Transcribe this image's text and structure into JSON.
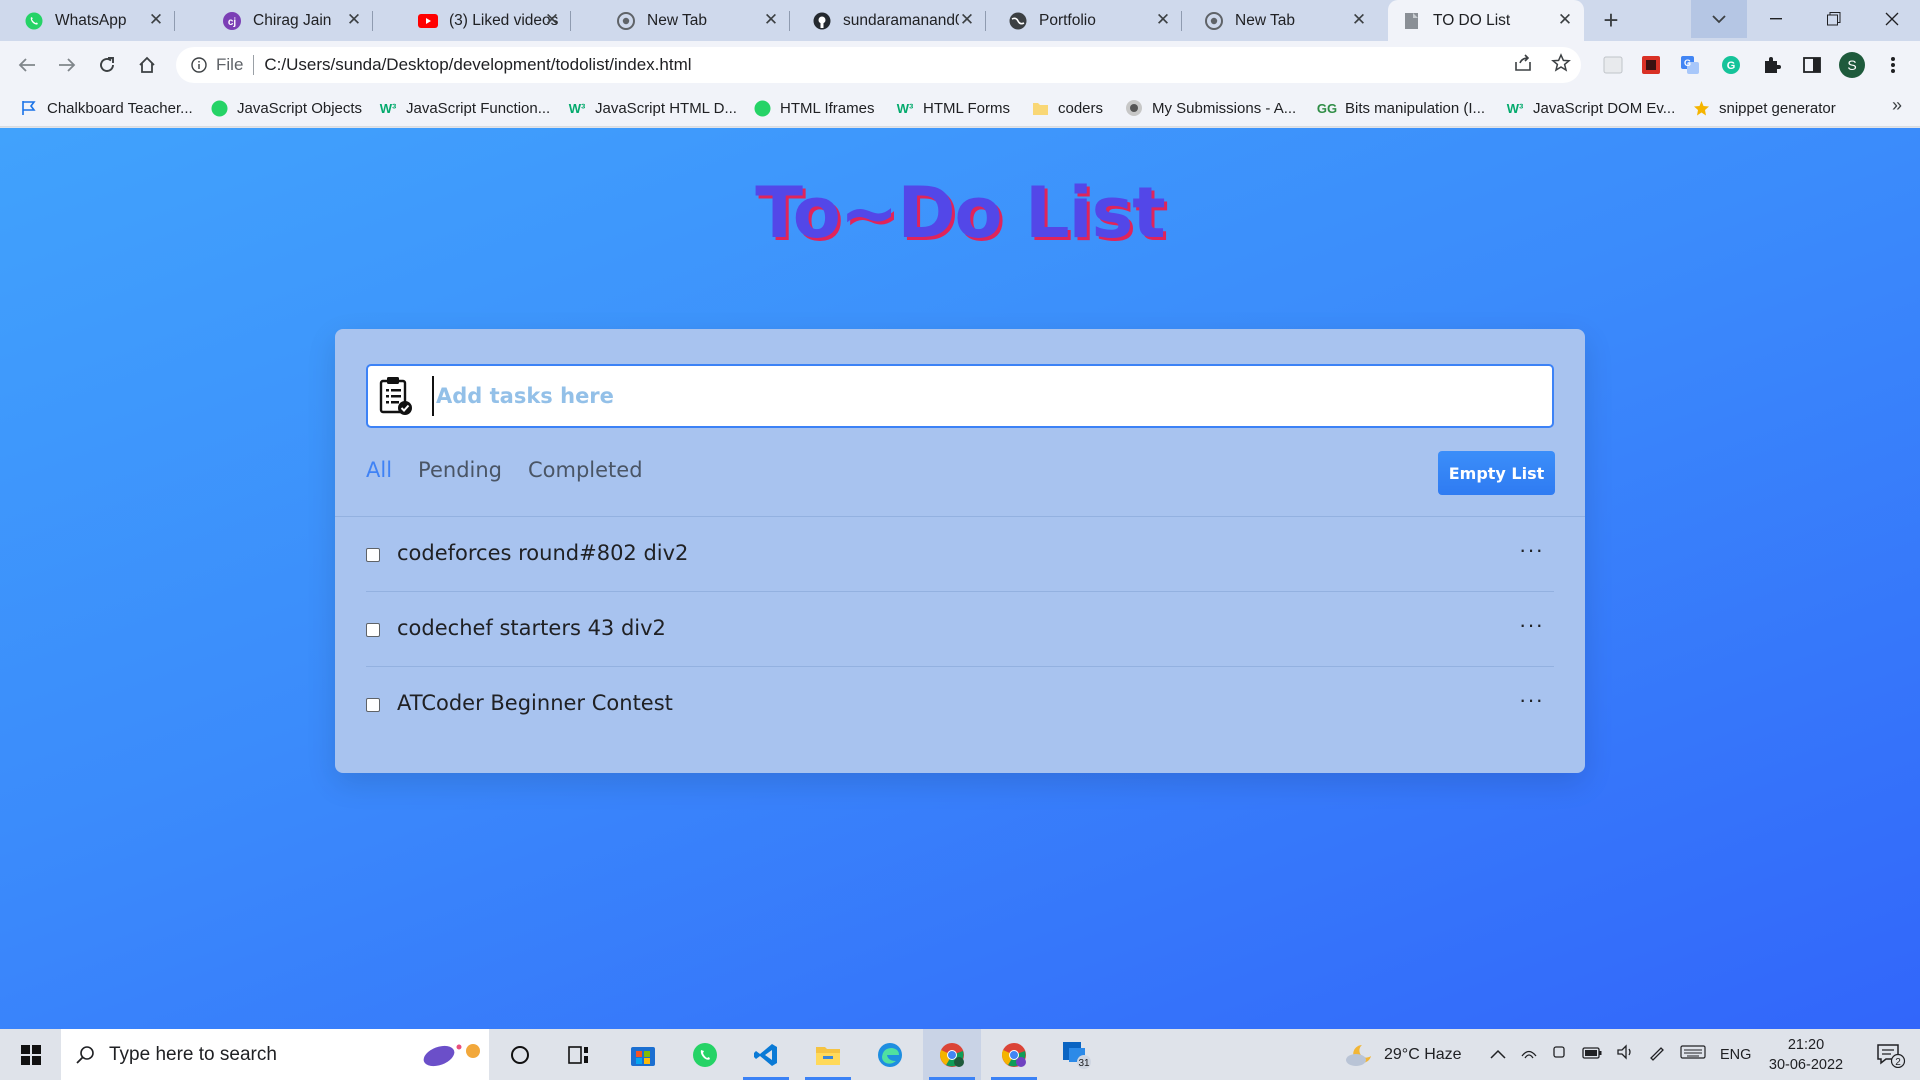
{
  "browser": {
    "tabs": [
      {
        "title": "WhatsApp",
        "icon": "whatsapp-icon",
        "active": false
      },
      {
        "title": "Chirag Jain",
        "icon": "cj-logo-icon",
        "active": false
      },
      {
        "title": "(3) Liked videos -",
        "icon": "youtube-icon",
        "active": false
      },
      {
        "title": "New Tab",
        "icon": "chrome-icon",
        "active": false
      },
      {
        "title": "sundaramanand0",
        "icon": "github-icon",
        "active": false
      },
      {
        "title": "Portfolio",
        "icon": "globe-icon",
        "active": false
      },
      {
        "title": "New Tab",
        "icon": "chrome-icon",
        "active": false
      },
      {
        "title": "TO DO List",
        "icon": "page-icon",
        "active": true
      }
    ],
    "address": {
      "scheme_label": "File",
      "url": "C:/Users/sunda/Desktop/development/todolist/index.html"
    },
    "profile_initial": "S",
    "bookmarks": [
      {
        "label": "Chalkboard Teacher...",
        "icon": "flag-icon"
      },
      {
        "label": "JavaScript Objects",
        "icon": "whatsapp-icon"
      },
      {
        "label": "JavaScript Function...",
        "icon": "w3schools-icon"
      },
      {
        "label": "JavaScript HTML D...",
        "icon": "w3schools-icon"
      },
      {
        "label": "HTML Iframes",
        "icon": "whatsapp-icon"
      },
      {
        "label": "HTML Forms",
        "icon": "w3schools-icon"
      },
      {
        "label": "coders",
        "icon": "folder-icon"
      },
      {
        "label": "My Submissions - A...",
        "icon": "atcoder-icon"
      },
      {
        "label": "Bits manipulation (I...",
        "icon": "gfg-icon"
      },
      {
        "label": "JavaScript DOM Ev...",
        "icon": "w3schools-icon"
      },
      {
        "label": "snippet generator",
        "icon": "star-badge-icon"
      }
    ],
    "bookmarks_overflow": "»"
  },
  "app": {
    "title": "To~Do List",
    "input_placeholder": "Add tasks here",
    "filters": [
      {
        "label": "All",
        "active": true
      },
      {
        "label": "Pending",
        "active": false
      },
      {
        "label": "Completed",
        "active": false
      }
    ],
    "empty_button": "Empty List",
    "tasks": [
      {
        "label": "codeforces round#802 div2",
        "checked": false
      },
      {
        "label": "codechef starters 43 div2",
        "checked": false
      },
      {
        "label": "ATCoder Beginner Contest",
        "checked": false
      }
    ],
    "more_icon": "···"
  },
  "taskbar": {
    "search_placeholder": "Type here to search",
    "weather": "29°C  Haze",
    "language": "ENG",
    "time": "21:20",
    "date": "30-06-2022",
    "notification_count": "2",
    "outlook_badge": "31"
  },
  "colors": {
    "accent": "#3f82f5",
    "title_fill": "#5347e8",
    "title_shadow": "#e0245a",
    "card_bg": "#a8c3ef"
  }
}
